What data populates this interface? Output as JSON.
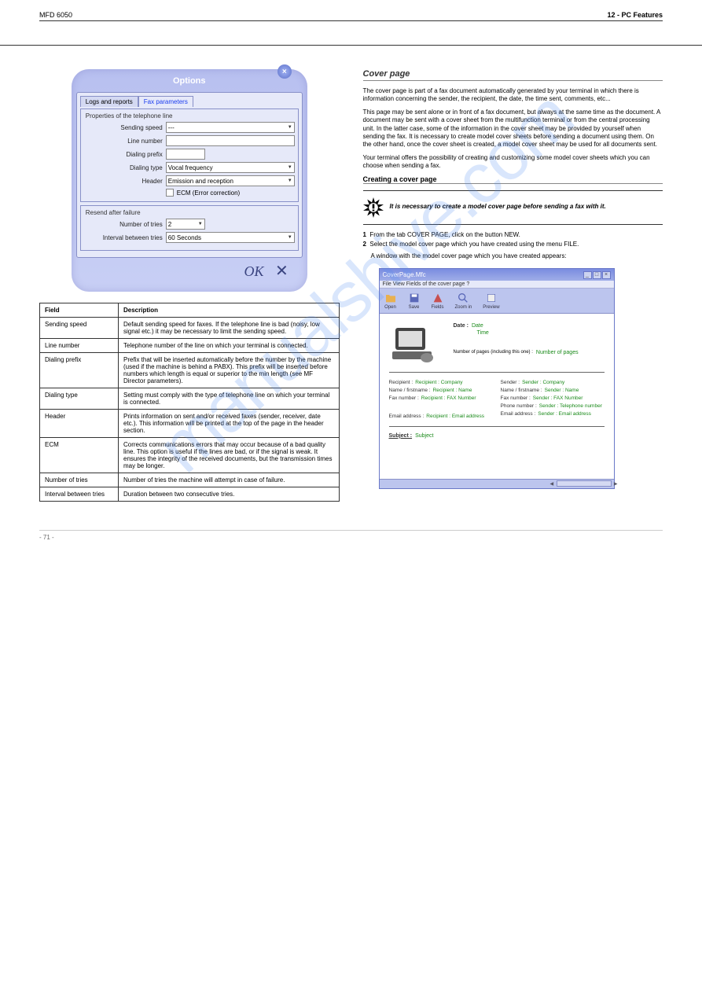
{
  "header": {
    "product": "MFD 6050",
    "section": "12 - PC Features"
  },
  "options": {
    "title": "Options",
    "tabs": {
      "logs": "Logs and reports",
      "fax": "Fax parameters"
    },
    "group1": "Properties of the telephone line",
    "sending_speed": "Sending speed",
    "sending_speed_val": "---",
    "line_number": "Line number",
    "dialing_prefix": "Dialing prefix",
    "dialing_type": "Dialing type",
    "dialing_type_val": "Vocal frequency",
    "header_field": "Header",
    "header_val": "Emission and reception",
    "ecm": "ECM (Error correction)",
    "group2": "Resend after failure",
    "ntries": "Number of tries",
    "ntries_val": "2",
    "interval": "Interval between tries",
    "interval_val": "60 Seconds",
    "ok": "OK",
    "cancel": "✕"
  },
  "param_table": {
    "h1": "Field",
    "h2": "Description",
    "rows": [
      [
        "Sending speed",
        "Default sending speed for faxes.\nIf the telephone line is bad (noisy, low signal etc.) it may be necessary to limit the sending speed."
      ],
      [
        "Line number",
        "Telephone number of the line on which your terminal is connected."
      ],
      [
        "Dialing prefix",
        "Prefix that will be inserted automatically before the number by the machine (used if the machine is behind a PABX).\nThis prefix will be inserted before numbers which length is equal or superior to the min length (see MF Director parameters)."
      ],
      [
        "Dialing type",
        "Setting must comply with the type of telephone line on which your terminal is connected."
      ],
      [
        "Header",
        "Prints information on sent and/or received faxes (sender, receiver, date etc.).\nThis information will be printed at the top of the page in the header section."
      ],
      [
        "ECM",
        "Corrects communications errors that may occur because of a bad quality line. This option is useful if the lines are bad, or if the signal is weak. It ensures the integrity of the received documents, but the transmission times may be longer."
      ],
      [
        "Number of tries",
        "Number of tries the machine will attempt in case of failure."
      ],
      [
        "Interval between tries",
        "Duration between two consecutive tries."
      ]
    ]
  },
  "cover_section": {
    "heading": "Cover page",
    "para1": "The cover page is part of a fax document automatically generated by your terminal in which there is information concerning the sender, the recipient, the date, the time sent, comments, etc...",
    "para2": "This page may be sent alone or in front of a fax document, but always at the same time as the document. A document may be sent with a cover sheet from the multifunction terminal or from the central processing unit. In the latter case, some of the information in the cover sheet may be provided by yourself when sending the fax. It is necessary to create model cover sheets before sending a document using them. On the other hand, once the cover sheet is created, a model cover sheet may be used for all documents sent.",
    "para3": "Your terminal offers the possibility of creating and customizing some model cover sheets which you can choose when sending a fax.",
    "sub_create": "Creating a cover page",
    "important": "It is necessary to create a model cover page before sending a fax with it.",
    "step1_num": "1",
    "step1": "From the tab COVER PAGE, click on the button NEW.",
    "step2_num": "2",
    "step2": "Select the model cover page which you have created using the menu FILE.",
    "step2_tail": "A window with the model cover page which you have created appears:"
  },
  "cover_window": {
    "title": "CoverPage.Mfc",
    "menu": "File   View   Fields of the cover page   ?",
    "toolbar": [
      "Open",
      "Save",
      "Fields",
      "Zoom in",
      "Preview"
    ],
    "date_lbl": "Date :",
    "date_val": "Date",
    "time_val": "Time",
    "np_lbl": "Number of pages (including this one) :",
    "np_val": "Number of pages",
    "left": {
      "recipient_lbl": "Recipient :",
      "recipient_val": "Recipient : Company",
      "name_lbl": "Name / firstname :",
      "name_val": "Recipient : Name",
      "fax_lbl": "Fax number :",
      "fax_val": "Recipient : FAX Number",
      "email_lbl": "Email address :",
      "email_val": "Recipient : Email address"
    },
    "right": {
      "sender_lbl": "Sender :",
      "sender_val": "Sender : Company",
      "name_lbl": "Name / firstname :",
      "name_val": "Sender : Name",
      "fax_lbl": "Fax number :",
      "fax_val": "Sender : FAX Number",
      "phone_lbl": "Phone number :",
      "phone_val": "Sender : Telephone number",
      "email_lbl": "Email address :",
      "email_val": "Sender : Email address"
    },
    "subject_lbl": "Subject :",
    "subject_val": "Subject"
  },
  "watermark": "manualshive.com",
  "footer": {
    "page": "- 71 -"
  }
}
